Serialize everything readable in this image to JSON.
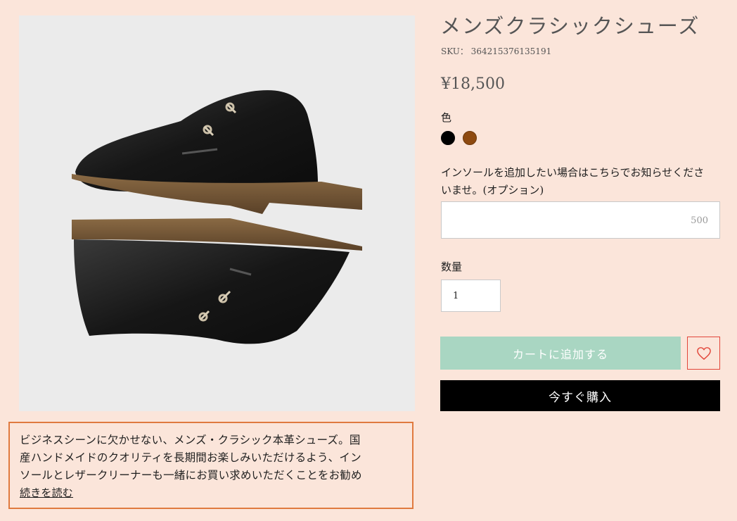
{
  "product": {
    "title": "メンズクラシックシューズ",
    "sku": "SKU： 364215376135191",
    "price": "¥18,500",
    "image_alt": "black leather chukka boots"
  },
  "options": {
    "color_label": "色",
    "colors": [
      {
        "name": "black",
        "hex": "#000000"
      },
      {
        "name": "brown",
        "hex": "#8e4a10"
      }
    ]
  },
  "insole": {
    "label": "インソールを追加したい場合はこちらでお知らせください ませ。(オプション)",
    "label_line1": "インソールを追加したい場合はこちらでお知らせくださ",
    "label_line2": "いませ。(オプション)",
    "value": "",
    "char_limit": "500"
  },
  "quantity": {
    "label": "数量",
    "value": "1"
  },
  "actions": {
    "add_to_cart": "カートに追加する",
    "buy_now": "今すぐ購入",
    "wishlist_icon": "heart-icon"
  },
  "description": {
    "line1": "ビジネスシーンに欠かせない、メンズ・クラシック本革シューズ。国",
    "line2": "産ハンドメイドのクオリティを長期間お楽しみいただけるよう、イン",
    "line3": "ソールとレザークリーナーも一緒にお買い求めいただくことをお勧め",
    "read_more": "続きを読む"
  },
  "colors": {
    "page_bg": "#fbe5da",
    "add_to_cart_bg": "#a9d6c2",
    "buy_now_bg": "#000000",
    "highlight_border": "#e07a3f",
    "wishlist_border": "#e2463a"
  }
}
